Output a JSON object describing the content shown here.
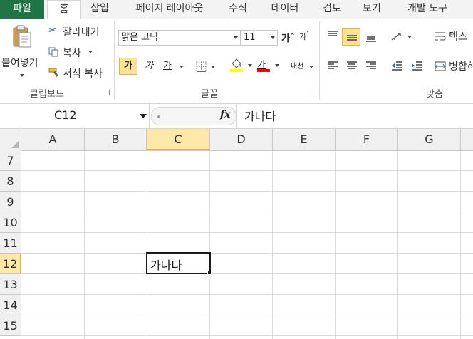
{
  "tabs": [
    {
      "label": "파일",
      "kind": "file"
    },
    {
      "label": "홈",
      "kind": "active"
    },
    {
      "label": "삽입"
    },
    {
      "label": "페이지 레이아웃"
    },
    {
      "label": "수식"
    },
    {
      "label": "데이터"
    },
    {
      "label": "검토"
    },
    {
      "label": "보기"
    },
    {
      "label": "개발 도구"
    }
  ],
  "clipboard": {
    "paste_label": "붙여넣기",
    "cut_label": "잘라내기",
    "copy_label": "복사",
    "format_painter_label": "서식 복사",
    "group_label": "클립보드"
  },
  "font": {
    "font_name": "맑은 고딕",
    "font_size": "11",
    "grow_label": "가",
    "shrink_label": "가",
    "bold_label": "가",
    "italic_label": "가",
    "underline_label": "가",
    "font_color_label": "가",
    "phonetic_label": "내천",
    "group_label": "글꼴"
  },
  "alignment": {
    "wrap_label": "텍스",
    "merge_label": "병합하",
    "group_label": "맞춤"
  },
  "formula_bar": {
    "name_box": "C12",
    "fx_label": "fx",
    "content": "가나다"
  },
  "grid": {
    "columns": [
      "A",
      "B",
      "C",
      "D",
      "E",
      "F",
      "G"
    ],
    "rows": [
      "7",
      "8",
      "9",
      "10",
      "11",
      "12",
      "13",
      "14",
      "15"
    ],
    "selected_cell_value": "가나다"
  },
  "colors": {
    "file_tab": "#1f7345",
    "highlight": "#fde293",
    "fill_color": "#ffff00",
    "font_color": "#ff0000"
  }
}
